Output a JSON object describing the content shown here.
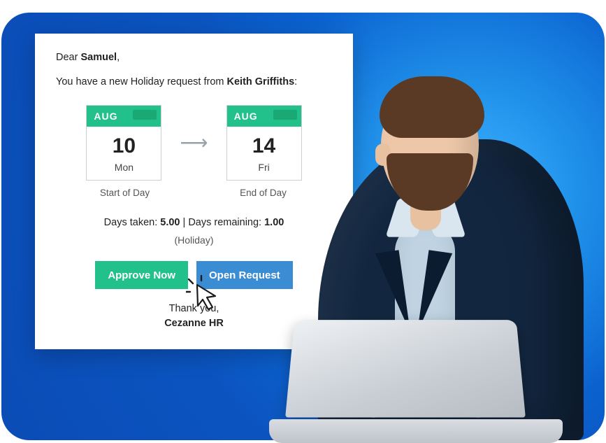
{
  "card": {
    "greeting_prefix": "Dear ",
    "recipient_name": "Samuel",
    "greeting_suffix": ",",
    "intro_prefix": "You have a new Holiday request from ",
    "requester_name": "Keith Griffiths",
    "intro_suffix": ":",
    "start": {
      "month": "AUG",
      "day": "10",
      "dow": "Mon",
      "caption": "Start of Day"
    },
    "end": {
      "month": "AUG",
      "day": "14",
      "dow": "Fri",
      "caption": "End of Day"
    },
    "summary": {
      "days_taken_label": "Days taken: ",
      "days_taken_value": "5.00",
      "separator": " | ",
      "days_remaining_label": "Days remaining: ",
      "days_remaining_value": "1.00",
      "type": "(Holiday)"
    },
    "buttons": {
      "approve": "Approve Now",
      "open": "Open Request"
    },
    "signoff": {
      "thanks": "Thank you,",
      "brand": "Cezanne HR"
    }
  },
  "colors": {
    "green": "#22c08a",
    "blue_button": "#3a8cd3",
    "bg_blue": "#0b54c0"
  }
}
